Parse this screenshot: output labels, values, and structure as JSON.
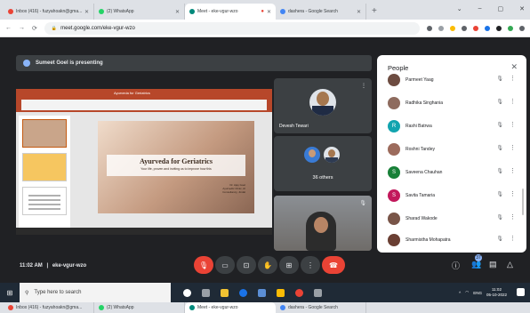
{
  "browser": {
    "tabs": [
      {
        "title": "Inbox (416) - fuzyahoakn@gma...",
        "color": "#ea4335"
      },
      {
        "title": "(2) WhatsApp",
        "color": "#25d366"
      },
      {
        "title": "Meet - eke-vgur-wzo",
        "color": "#00897b",
        "active": true
      },
      {
        "title": "dashera - Google Search",
        "color": "#4285f4"
      }
    ],
    "new_tab": "+",
    "window_controls": [
      "⌄",
      "–",
      "▢",
      "✕"
    ],
    "url": "meet.google.com/eke-vgur-wzo"
  },
  "meet": {
    "presenting": "Sumeet Goel is presenting",
    "slide": {
      "ribbon_title": "Ayurveda for Geriatrics",
      "title": "Ayurveda for Geriatrics",
      "subtitle": "Your life, proven and inviting us to improve how this",
      "credit_lines": [
        "Dr. Ajay Goel",
        "Ayurvedic Clinic, AI",
        "Consultancy, Jindal"
      ]
    },
    "tiles": [
      {
        "name": "Devesh Tewari"
      },
      {
        "name": "36 others"
      },
      {
        "name": ""
      }
    ],
    "time": "11:02 AM",
    "separator": "|",
    "meeting_code": "eke-vgur-wzo",
    "people_badge": "37"
  },
  "people_panel": {
    "title": "People",
    "close": "✕",
    "participants": [
      {
        "name": "Parmeet Yaag",
        "initial": "",
        "color": "#6d4c41"
      },
      {
        "name": "Radhika Singhania",
        "initial": "",
        "color": "#8e6b5e"
      },
      {
        "name": "Rashi Batrwa",
        "initial": "R",
        "color": "#12a4af"
      },
      {
        "name": "Roshni Tandey",
        "initial": "",
        "color": "#9c6b5c"
      },
      {
        "name": "Saveena Chauhan",
        "initial": "S",
        "color": "#188038"
      },
      {
        "name": "Savita Tamaria",
        "initial": "S",
        "color": "#c2185b"
      },
      {
        "name": "Sharad Wakode",
        "initial": "",
        "color": "#795548"
      },
      {
        "name": "Sharmistha Mohapatra",
        "initial": "",
        "color": "#6a3f33"
      }
    ]
  },
  "taskbar": {
    "search_placeholder": "Type here to search",
    "tray_lang": "ENG",
    "clock_time": "11:02",
    "clock_date": "05-10-2022"
  },
  "colors": {
    "meet_bg": "#202124",
    "end_call": "#ea4335",
    "accent": "#8ab4f8"
  }
}
